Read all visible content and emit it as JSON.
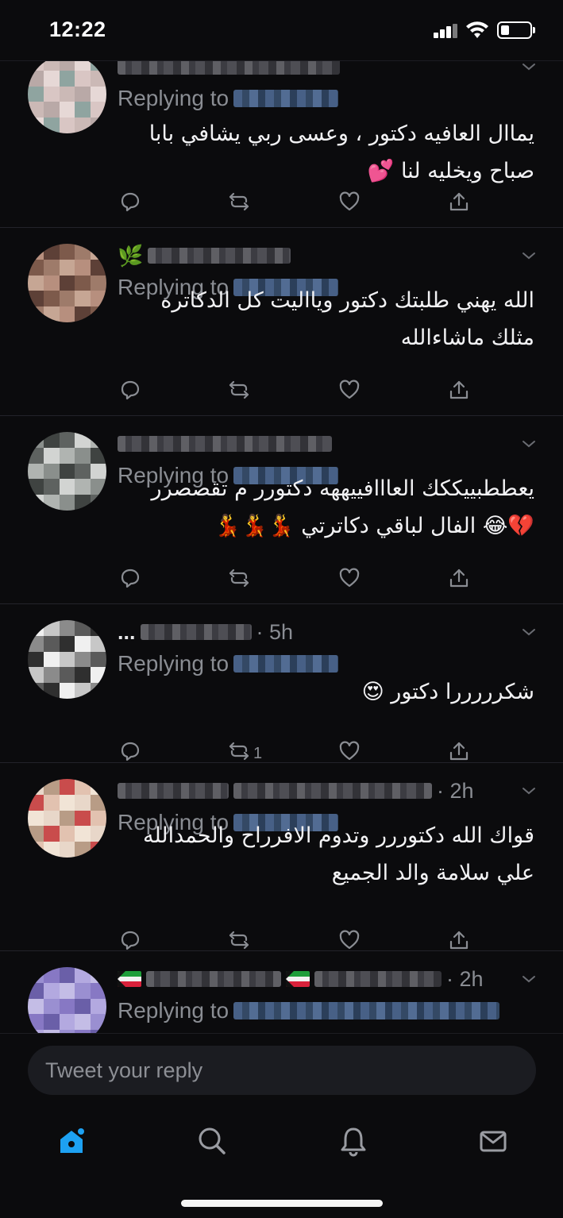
{
  "status_bar": {
    "time": "12:22"
  },
  "replies": [
    {
      "timestamp": "",
      "has_ellipsis": false,
      "replying_label": "Replying to",
      "text_lines": [
        "يماال العافيه دكتور ، وعسى ربي يشافي بابا",
        "صباح ويخليه لنا 💕"
      ],
      "retweet_count": "",
      "avatar_colors": [
        "#d9c6c4",
        "#b9a9a7",
        "#8fa4a0",
        "#cbb9b6",
        "#e6d8d6"
      ]
    },
    {
      "timestamp": "",
      "has_ellipsis": false,
      "replying_label": "Replying to",
      "text_lines": [
        "الله يهني طلبتك دكتور ويااليت كل الدكاتره",
        "مثلك ماشاءالله"
      ],
      "retweet_count": "",
      "avatar_colors": [
        "#b78f7e",
        "#7d5a4b",
        "#c6a694",
        "#5d4037",
        "#9e7b6a"
      ]
    },
    {
      "timestamp": "",
      "has_ellipsis": false,
      "replying_label": "Replying to",
      "text_lines": [
        "يعططبييككك العااافييههه دكتورر م تقصصرر",
        "💔😂 الفال لباقي دكاترتي 💃💃💃"
      ],
      "retweet_count": "",
      "avatar_colors": [
        "#8a8f8c",
        "#5e6260",
        "#b0b4b1",
        "#3f4341",
        "#d2d4d2"
      ]
    },
    {
      "timestamp": "· 5h",
      "has_ellipsis": true,
      "replying_label": "Replying to",
      "text_lines": [
        "شكرررررا دكتور 😍"
      ],
      "retweet_count": "1",
      "avatar_colors": [
        "#f0f0f0",
        "#8b8b8b",
        "#2f2f2f",
        "#c7c7c7",
        "#5a5a5a"
      ]
    },
    {
      "timestamp": "· 2h",
      "has_ellipsis": false,
      "replying_label": "Replying to",
      "text_lines": [
        "قواك الله دكتوررر وتدوم الافرراح والحمدالله",
        "علي سلامة والد الجميع"
      ],
      "retweet_count": "",
      "avatar_colors": [
        "#e8d7c9",
        "#c94c4c",
        "#f1e4d6",
        "#b89c86",
        "#e2c2b0"
      ]
    },
    {
      "timestamp": "· 2h",
      "has_ellipsis": false,
      "replying_label": "Replying to",
      "text_lines": [],
      "retweet_count": "",
      "avatar_colors": [
        "#9a8fd1",
        "#6a5fa8",
        "#c4bde6",
        "#8778c4",
        "#b3a9e0"
      ]
    }
  ],
  "compose": {
    "placeholder": "Tweet your reply"
  },
  "icons": {
    "reply": "reply-icon",
    "retweet": "retweet-icon",
    "like": "like-icon",
    "share": "share-icon",
    "home": "home-icon",
    "search": "search-icon",
    "notifications": "bell-icon",
    "messages": "mail-icon"
  },
  "colors": {
    "background": "#0b0b0d",
    "accent": "#1da1f2",
    "muted": "#8a8d93",
    "text": "#f2f2f4"
  }
}
